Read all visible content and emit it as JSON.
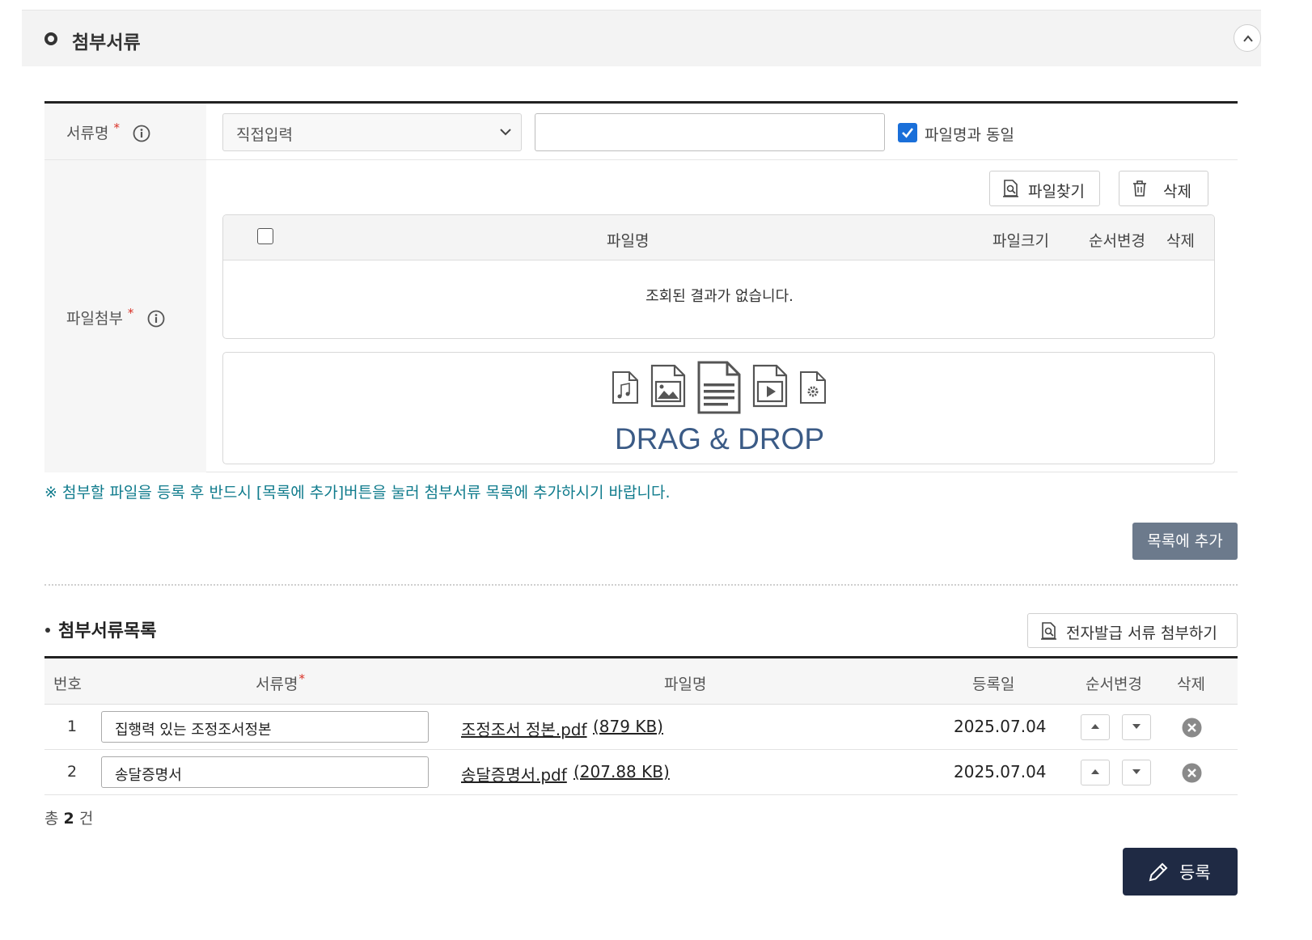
{
  "section": {
    "title": "첨부서류"
  },
  "form": {
    "doc_name_label": "서류명",
    "required_mark": "*",
    "file_attach_label": "파일첨부",
    "select_value": "직접입력",
    "text_input_value": "",
    "same_as_filename_label": "파일명과 동일",
    "same_as_filename_checked": true,
    "find_file_button": "파일찾기",
    "delete_button": "삭제",
    "file_grid": {
      "headers": {
        "filename": "파일명",
        "filesize": "파일크기",
        "reorder": "순서변경",
        "delete": "삭제"
      },
      "empty_message": "조회된 결과가 없습니다."
    },
    "dropzone_text": "DRAG & DROP"
  },
  "notice": "※ 첨부할 파일을 등록 후 반드시 [목록에 추가]버튼을 눌러 첨부서류 목록에 추가하시기 바랍니다.",
  "add_to_list_button": "목록에 추가",
  "list": {
    "title": "첨부서류목록",
    "edoc_button": "전자발급 서류 첨부하기",
    "headers": {
      "no": "번호",
      "doc_name": "서류명",
      "filename": "파일명",
      "date": "등록일",
      "reorder": "순서변경",
      "delete": "삭제"
    },
    "rows": [
      {
        "no": "1",
        "doc_name": "집행력 있는 조정조서정본",
        "filename": "조정조서 정본.pdf",
        "filesize": "(879 KB)",
        "date": "2025.07.04"
      },
      {
        "no": "2",
        "doc_name": "송달증명서",
        "filename": "송달증명서.pdf",
        "filesize": "(207.88 KB)",
        "date": "2025.07.04"
      }
    ],
    "total_prefix": "총",
    "total_count": "2",
    "total_suffix": "건"
  },
  "register_button": "등록",
  "colors": {
    "accent": "#1a6fd9",
    "notice": "#0f7b8c",
    "dropzone": "#3b5b86",
    "register_bg": "#1f2a44",
    "addlist_bg": "#6c7a8c"
  }
}
